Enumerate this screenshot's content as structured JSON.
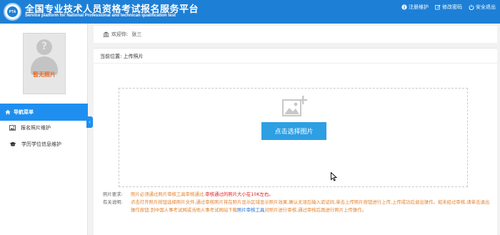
{
  "header": {
    "logo_text": "PTA",
    "title_cn": "全国专业技术人员资格考试报名服务平台",
    "title_en": "Service platform for National Professional and technican qualification test",
    "links": [
      {
        "label": "注册维护",
        "icon": "info-icon"
      },
      {
        "label": "修改密码",
        "icon": "edit-icon"
      },
      {
        "label": "安全退出",
        "icon": "power-icon"
      }
    ]
  },
  "sidebar": {
    "photo_label": "暂无照片",
    "nav_title": "导航菜单",
    "items": [
      {
        "label": "报名照片维护",
        "icon": "image-icon"
      },
      {
        "label": "学历学位信息维护",
        "icon": "graduation-cap-icon"
      }
    ],
    "collapse_glyph": "‹"
  },
  "welcome": {
    "label": "欢迎你:",
    "name": "张三"
  },
  "panel": {
    "breadcrumb": "当前位置: 上传照片",
    "choose_button": "点击选择图片"
  },
  "notes": {
    "req_label": "照片要求:",
    "req_text": "照片必须通过照片审核工具审核通过,",
    "req_red": "审核通过的照片大小在10K左右。",
    "desc_label": "有关说明:",
    "desc_text1": "点击打开照片按钮选择照片文件,通过审核照片将在照片显示区域显示照片效果,确认无误后输入验证码,单击上传照片按钮进行上传,上传成功后退出操作。如未经过审核,请单击退出操作按钮,到中国人事考试网或当地人事考试网站下载",
    "desc_link": "照片审核工具",
    "desc_text2": "对照片进行审核,通过审核后再进行照片上传操作。"
  },
  "colors": {
    "header_bg": "#1e7fd6",
    "nav_active": "#1e8ff0",
    "button": "#2d9fe3",
    "warn": "#e02020",
    "note": "#e0822e"
  }
}
